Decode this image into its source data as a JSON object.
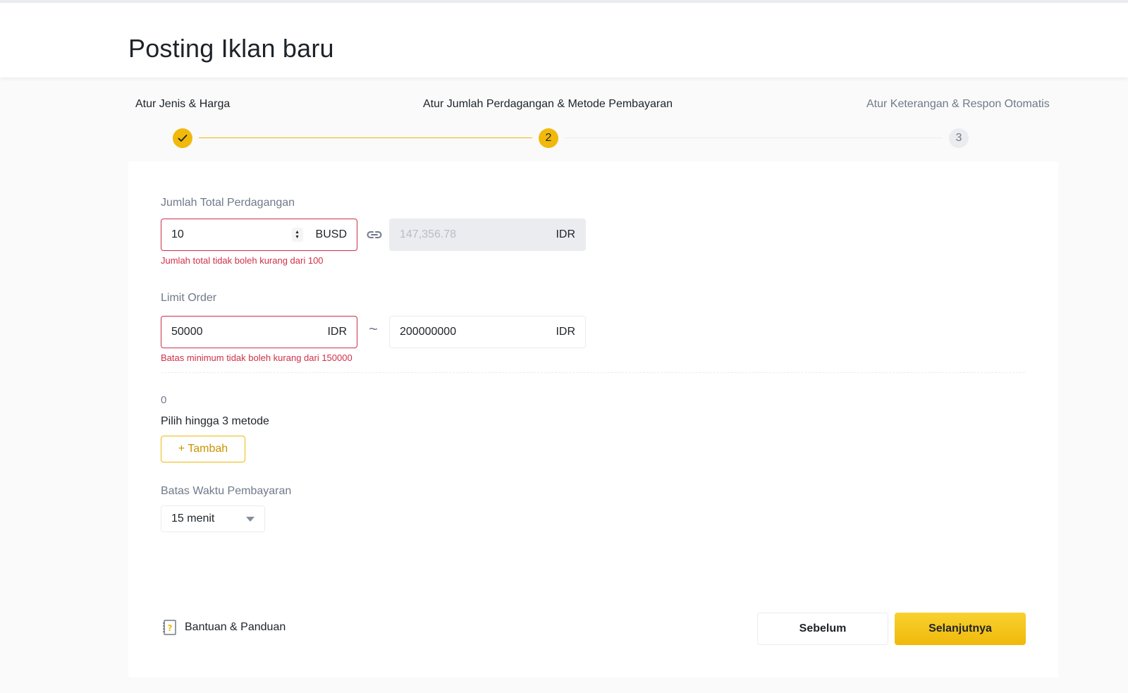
{
  "page": {
    "title": "Posting Iklan baru"
  },
  "stepper": {
    "steps": [
      {
        "label": "Atur Jenis & Harga",
        "number": "",
        "state": "done"
      },
      {
        "label": "Atur Jumlah Perdagangan & Metode Pembayaran",
        "number": "2",
        "state": "active"
      },
      {
        "label": "Atur Keterangan & Respon Otomatis",
        "number": "3",
        "state": "pending"
      }
    ]
  },
  "total_amount": {
    "label": "Jumlah Total Perdagangan",
    "crypto_value": "10",
    "crypto_unit": "BUSD",
    "fiat_value": "147,356.78",
    "fiat_unit": "IDR",
    "error": "Jumlah total tidak boleh kurang dari 100"
  },
  "order_limit": {
    "label": "Limit Order",
    "min_value": "50000",
    "min_unit": "IDR",
    "separator": "~",
    "max_value": "200000000",
    "max_unit": "IDR",
    "error": "Batas minimum tidak boleh kurang dari 150000"
  },
  "payment_methods": {
    "count": "0",
    "hint": "Pilih hingga 3 metode",
    "add_label": "+ Tambah"
  },
  "payment_time": {
    "label": "Batas Waktu Pembayaran",
    "selected": "15 menit"
  },
  "footer": {
    "help_label": "Bantuan & Panduan",
    "prev_label": "Sebelum",
    "next_label": "Selanjutnya"
  },
  "colors": {
    "accent": "#f0b90b",
    "error": "#cf304a",
    "muted": "#707a8a"
  }
}
